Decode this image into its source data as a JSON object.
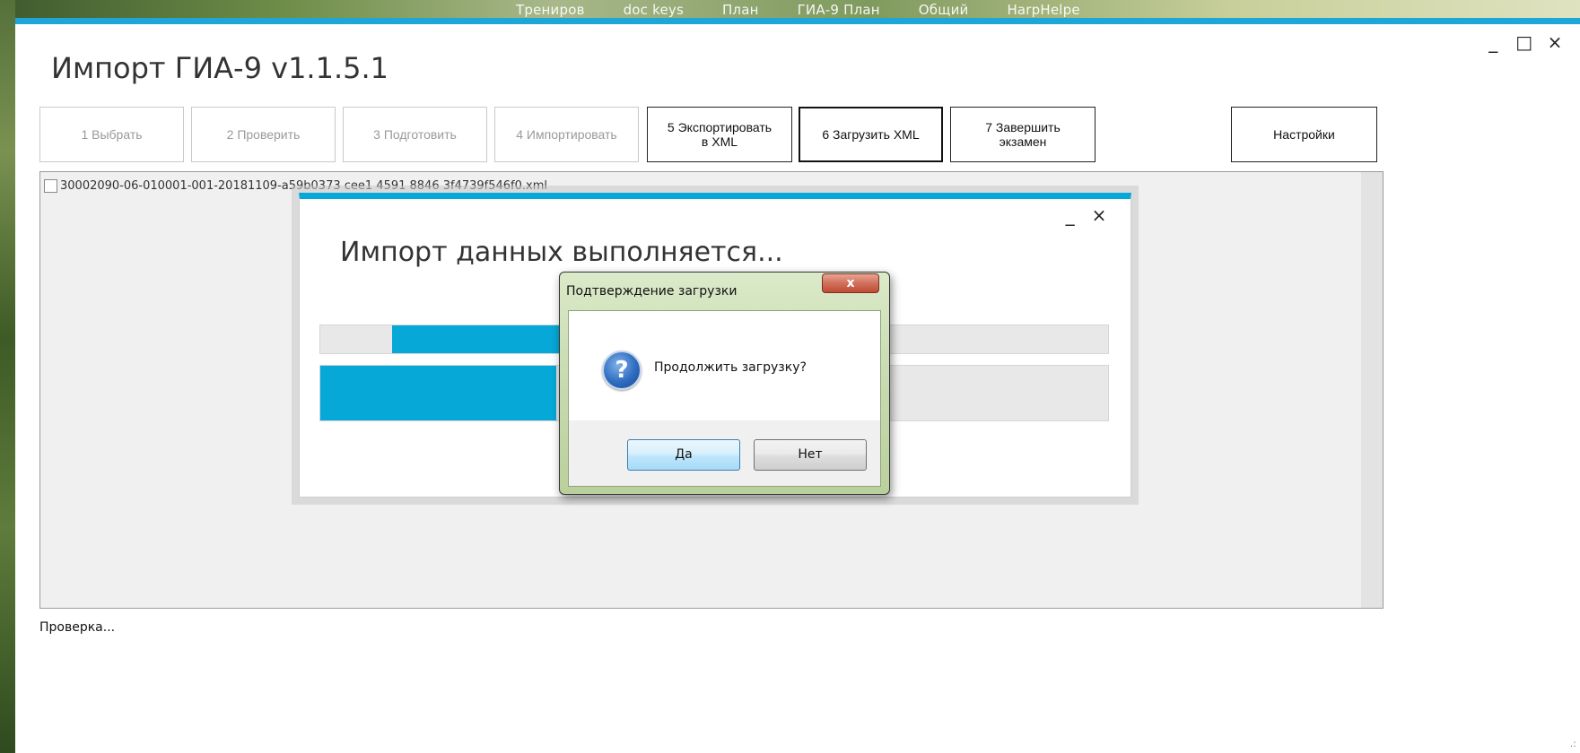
{
  "desktop": {
    "bookmarks": [
      "Трениров",
      "doc keys",
      "План",
      "ГИА-9 План",
      "Общий",
      "HarpHelpe"
    ]
  },
  "window": {
    "title": "Импорт ГИА-9 v1.1.5.1",
    "controls": {
      "minimize": "_",
      "maximize": "□",
      "close": "×"
    }
  },
  "steps": [
    {
      "label": "1  Выбрать",
      "state": "disabled"
    },
    {
      "label": "2  Проверить",
      "state": "disabled"
    },
    {
      "label": "3  Подготовить",
      "state": "disabled"
    },
    {
      "label": "4 Импортировать",
      "state": "disabled"
    },
    {
      "label": "5 Экспортировать\nв XML",
      "state": "enabled"
    },
    {
      "label": "6 Загрузить XML",
      "state": "selected"
    },
    {
      "label": "7 Завершить\nэкзамен",
      "state": "enabled"
    }
  ],
  "settings_label": "Настройки",
  "file_list": [
    {
      "name": "30002090-06-010001-001-20181109-a59b0373 cee1 4591 8846 3f4739f546f0.xml",
      "checked": false
    }
  ],
  "status": "Проверка...",
  "progress_window": {
    "title": "Импорт данных выполняется...",
    "controls": {
      "minimize": "_",
      "close": "×"
    },
    "progress1": 0.4,
    "progress2": 0.3
  },
  "dialog": {
    "title": "Подтверждение загрузки",
    "close_label": "x",
    "icon": "question-icon",
    "message": "Продолжить загрузку?",
    "yes_label": "Да",
    "no_label": "Нет"
  },
  "colors": {
    "accent": "#06a8d8",
    "window_border": "#1ea6d8"
  }
}
